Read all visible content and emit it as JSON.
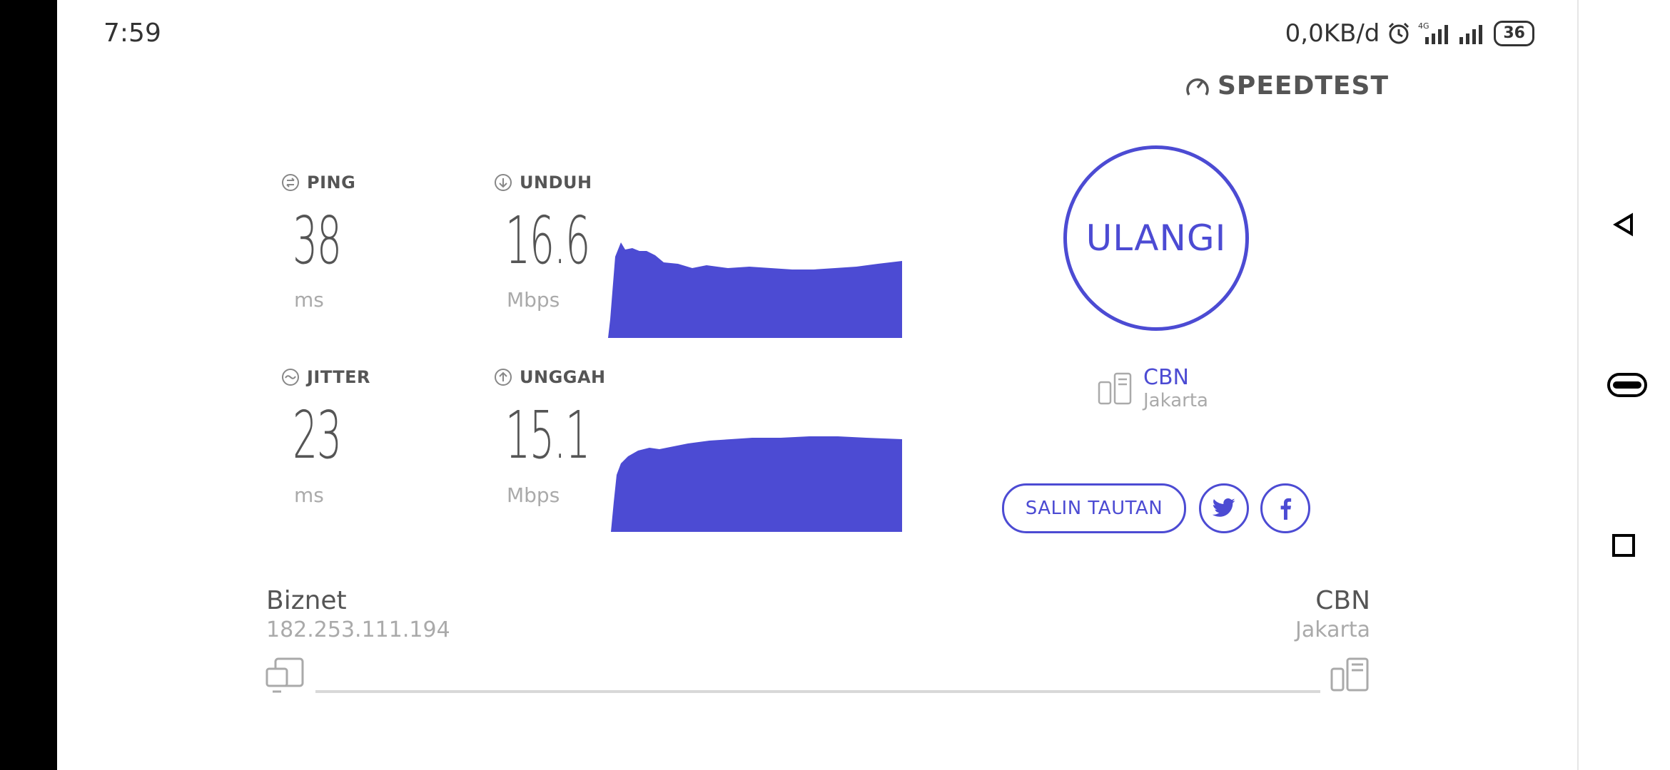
{
  "status_bar": {
    "time": "7:59",
    "data_rate": "0,0KB/d",
    "network_type": "4G",
    "battery": "36",
    "icons": [
      "alarm-icon",
      "signal-icon",
      "signal-icon",
      "battery-icon"
    ]
  },
  "brand": {
    "logo_text": "SPEEDTEST",
    "accent_color": "#4c4bd3"
  },
  "metrics": {
    "ping": {
      "label": "PING",
      "value": "38",
      "unit": "ms",
      "icon": "ping-icon"
    },
    "jitter": {
      "label": "JITTER",
      "value": "23",
      "unit": "ms",
      "icon": "jitter-icon"
    },
    "download": {
      "label": "UNDUH",
      "value": "16.6",
      "unit": "Mbps",
      "icon": "download-icon"
    },
    "upload": {
      "label": "UNGGAH",
      "value": "15.1",
      "unit": "Mbps",
      "icon": "upload-icon"
    }
  },
  "restart_label": "ULANGI",
  "server": {
    "name": "CBN",
    "city": "Jakarta"
  },
  "share": {
    "copy_link_label": "SALIN TAUTAN",
    "twitter_icon": "twitter-icon",
    "facebook_icon": "facebook-icon"
  },
  "connection": {
    "isp_name": "Biznet",
    "ip": "182.253.111.194",
    "dest_name": "CBN",
    "dest_city": "Jakarta"
  },
  "nav": [
    "back-icon",
    "home-icon",
    "recents-icon"
  ]
}
